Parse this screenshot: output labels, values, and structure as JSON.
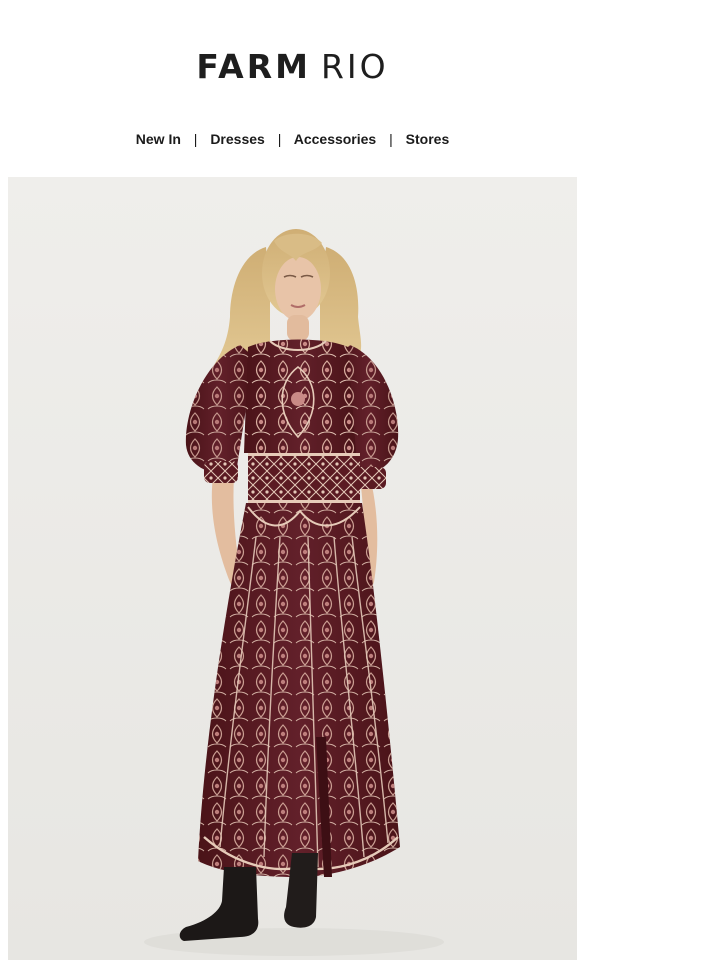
{
  "brand": {
    "primary": "FARM",
    "secondary": "RIO"
  },
  "nav": {
    "items": [
      {
        "label": "New In"
      },
      {
        "label": "Dresses"
      },
      {
        "label": "Accessories"
      },
      {
        "label": "Stores"
      }
    ],
    "separator": "|"
  },
  "hero": {
    "subject": "model wearing burgundy embroidered maxi dress",
    "colors": {
      "background": "#eeedea",
      "dress": "#5b1a20",
      "embroidery": "#d9b3a6",
      "hair": "#d9bd86",
      "skin": "#e6c1a4",
      "boots": "#1a1716"
    }
  }
}
